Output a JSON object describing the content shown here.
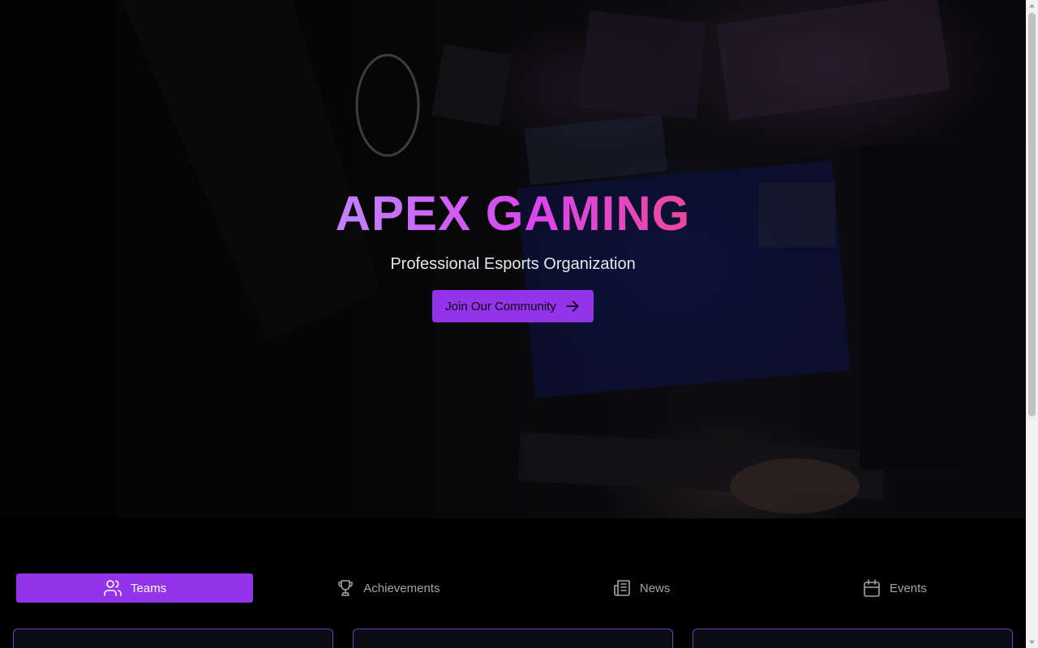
{
  "hero": {
    "title": "APEX GAMING",
    "subtitle": "Professional Esports Organization",
    "cta_label": "Join Our Community",
    "cta_icon": "arrow-right-icon"
  },
  "tabs": [
    {
      "label": "Teams",
      "icon": "users-icon",
      "active": true
    },
    {
      "label": "Achievements",
      "icon": "trophy-icon",
      "active": false
    },
    {
      "label": "News",
      "icon": "newspaper-icon",
      "active": false
    },
    {
      "label": "Events",
      "icon": "calendar-icon",
      "active": false
    }
  ],
  "colors": {
    "accent": "#9333ea",
    "title_gradient_start": "#c084fc",
    "title_gradient_end": "#ec4899",
    "card_border": "#6b3fb0"
  }
}
